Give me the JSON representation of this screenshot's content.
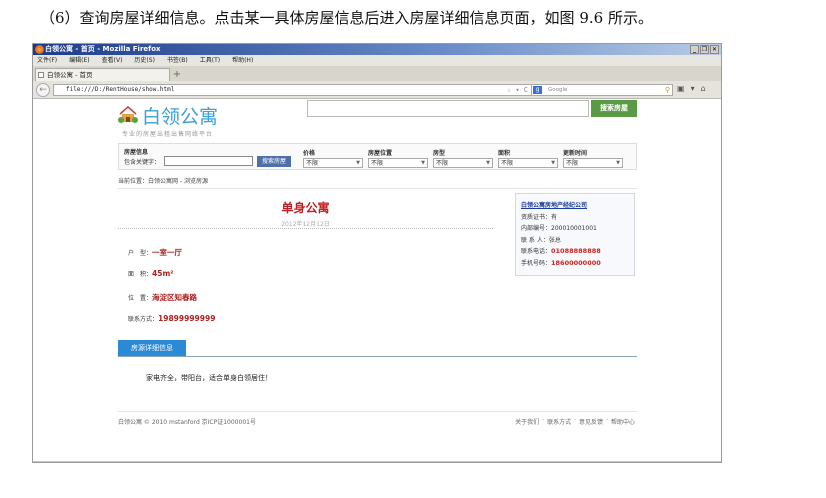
{
  "caption": "（6）查询房屋详细信息。点击某一具体房屋信息后进入房屋详细信息页面，如图 9.6 所示。",
  "browser": {
    "title": "白领公寓 - 首页 - Mozilla Firefox",
    "window_buttons": [
      "_",
      "❐",
      "✕"
    ],
    "menu": [
      "文件(F)",
      "编辑(E)",
      "查看(V)",
      "历史(S)",
      "书签(B)",
      "工具(T)",
      "帮助(H)"
    ],
    "tab_title": "白领公寓 - 首页",
    "new_tab": "+",
    "url": "file:///D:/RentHouse/show.html",
    "search_placeholder": "Google"
  },
  "site": {
    "logo": "白领公寓",
    "slogan": "专业的房屋出租出售网络平台",
    "search_button": "搜索房屋",
    "filter": {
      "title": "房屋信息",
      "keyword_label": "包含关键字：",
      "keyword_button": "搜索房屋",
      "selects": [
        {
          "label": "价格",
          "value": "不限"
        },
        {
          "label": "房屋位置",
          "value": "不限"
        },
        {
          "label": "房型",
          "value": "不限"
        },
        {
          "label": "面积",
          "value": "不限"
        },
        {
          "label": "更新时间",
          "value": "不限"
        }
      ]
    },
    "breadcrumb": "当前位置：白领公寓网 - 浏览房源",
    "house": {
      "title": "单身公寓",
      "date": "2012年12月12日",
      "fields": [
        {
          "label": "户　型：",
          "value": "一室一厅"
        },
        {
          "label": "面　积：",
          "value": "45m²"
        },
        {
          "label": "位　置：",
          "value": "海淀区知春路"
        },
        {
          "label": "联系方式：",
          "value": "19899999999"
        }
      ]
    },
    "agency": {
      "name": "白领公寓房地产经纪公司",
      "rows": [
        {
          "label": "资质证书：",
          "value": "有"
        },
        {
          "label": "内部编号：",
          "value": "200010001001"
        },
        {
          "label": "联 系 人：",
          "value": "张总"
        },
        {
          "label": "联系电话：",
          "value": "01088888888"
        },
        {
          "label": "手机号码：",
          "value": "18600000000"
        }
      ]
    },
    "detail_tab": "房源详细信息",
    "description": "家电齐全，带阳台，适合单身白领居住！",
    "footer_left": "白领公寓 © 2010 mstanford 京ICP证1000001号",
    "footer_links": [
      "关于我们",
      "联系方式",
      "意见反馈",
      "帮助中心"
    ]
  }
}
